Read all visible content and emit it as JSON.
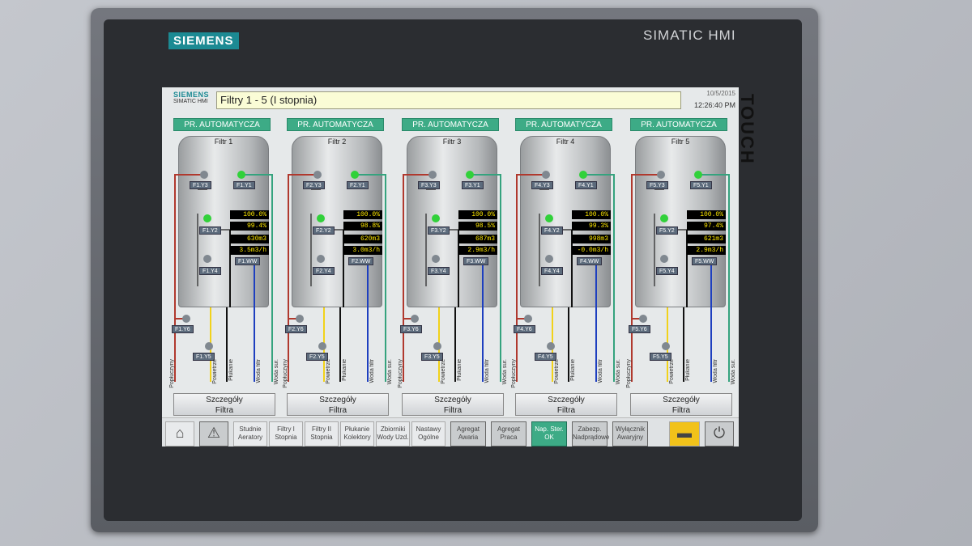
{
  "device": {
    "brand_logo": "SIEMENS",
    "product": "SIMATIC HMI",
    "touch_label": "TOUCH"
  },
  "screen": {
    "logo_brand": "SIEMENS",
    "logo_sub": "SIMATIC HMI",
    "title": "Filtry 1 - 5 (I stopnia)",
    "date": "10/5/2015",
    "time": "12:26:40 PM"
  },
  "filters": [
    {
      "mode": "PR. AUTOMATYCZA",
      "name": "Filtr 1",
      "y3": "F1.Y3",
      "y1": "F1.Y1",
      "y2": "F1.Y2",
      "y4": "F1.Y4",
      "ww": "F1.WW",
      "y6": "F1.Y6",
      "y5": "F1.Y5",
      "v1": "100.0%",
      "v2": "99.4%",
      "v3": "630m3",
      "v4": "3.5m3/h",
      "details_line1": "Szczegóły",
      "details_line2": "Filtra"
    },
    {
      "mode": "PR. AUTOMATYCZA",
      "name": "Filtr 2",
      "y3": "F2.Y3",
      "y1": "F2.Y1",
      "y2": "F2.Y2",
      "y4": "F2.Y4",
      "ww": "F2.WW",
      "y6": "F2.Y6",
      "y5": "F2.Y5",
      "v1": "100.0%",
      "v2": "98.8%",
      "v3": "620m3",
      "v4": "3.0m3/h",
      "details_line1": "Szczegóły",
      "details_line2": "Filtra"
    },
    {
      "mode": "PR. AUTOMATYCZA",
      "name": "Filtr 3",
      "y3": "F3.Y3",
      "y1": "F3.Y1",
      "y2": "F3.Y2",
      "y4": "F3.Y4",
      "ww": "F3.WW",
      "y6": "F3.Y6",
      "y5": "F3.Y5",
      "v1": "100.0%",
      "v2": "98.5%",
      "v3": "687m3",
      "v4": "2.9m3/h",
      "details_line1": "Szczegóły",
      "details_line2": "Filtra"
    },
    {
      "mode": "PR. AUTOMATYCZA",
      "name": "Filtr 4",
      "y3": "F4.Y3",
      "y1": "F4.Y1",
      "y2": "F4.Y2",
      "y4": "F4.Y4",
      "ww": "F4.WW",
      "y6": "F4.Y6",
      "y5": "F4.Y5",
      "v1": "100.0%",
      "v2": "99.3%",
      "v3": "998m3",
      "v4": "-0.0m3/h",
      "details_line1": "Szczegóły",
      "details_line2": "Filtra"
    },
    {
      "mode": "PR. AUTOMATYCZA",
      "name": "Filtr 5",
      "y3": "F5.Y3",
      "y1": "F5.Y1",
      "y2": "F5.Y2",
      "y4": "F5.Y4",
      "ww": "F5.WW",
      "y6": "F5.Y6",
      "y5": "F5.Y5",
      "v1": "100.0%",
      "v2": "97.4%",
      "v3": "621m3",
      "v4": "2.9m3/h",
      "details_line1": "Szczegóły",
      "details_line2": "Filtra"
    }
  ],
  "pipe_labels": {
    "popluczyny": "Popłuczyny",
    "powietrze": "Powietrze",
    "plukanie": "Płukanie",
    "woda_filtr": "Woda filtr",
    "woda_sur": "Woda sur."
  },
  "nav": {
    "home_icon": "home-icon",
    "alarm_icon": "warning-icon",
    "b1": [
      "Studnie",
      "Aeratory"
    ],
    "b2": [
      "Filtry I",
      "Stopnia"
    ],
    "b3": [
      "Filtry II",
      "Stopnia"
    ],
    "b4": [
      "Płukanie",
      "Kolektory"
    ],
    "b5": [
      "Zbiorniki",
      "Wody Uzd."
    ],
    "b6": [
      "Nastawy",
      "Ogólne"
    ],
    "b7": [
      "Agregat",
      "Awaria"
    ],
    "b8": [
      "Agregat",
      "Praca"
    ],
    "b9": [
      "Nap. Ster.",
      "OK"
    ],
    "b10": [
      "Zabezp.",
      "Nadprądowe"
    ],
    "b11": [
      "Wyłącznik",
      "Awaryjny"
    ],
    "folder_icon": "folder-icon",
    "power_icon": "power-icon"
  },
  "colors": {
    "accent": "#3dab86",
    "pipe_red": "#b0392e",
    "pipe_yellow": "#f1d21b",
    "pipe_blue": "#1e3fbf",
    "pipe_green": "#35a37e",
    "valve_on": "#31d13a",
    "valve_off": "#808890"
  }
}
